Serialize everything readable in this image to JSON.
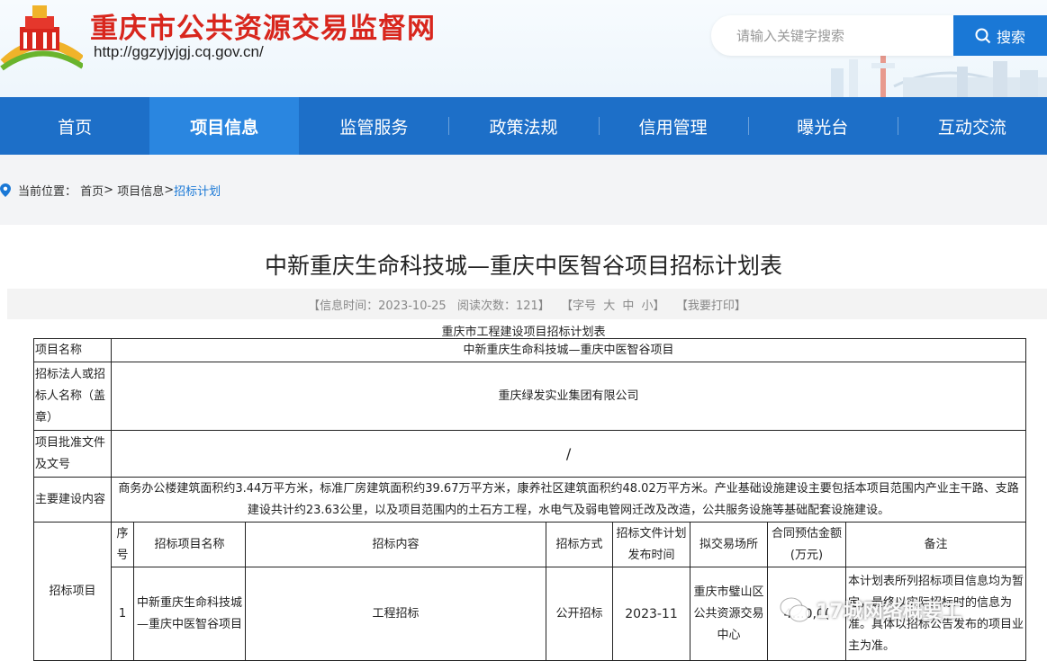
{
  "header": {
    "site_title": "重庆市公共资源交易监督网",
    "site_url": "http://ggzyjyjgj.cq.gov.cn/",
    "search_placeholder": "请输入关键字搜索",
    "search_button": "搜索"
  },
  "nav": {
    "items": [
      {
        "label": "首页"
      },
      {
        "label": "项目信息",
        "active": true
      },
      {
        "label": "监管服务"
      },
      {
        "label": "政策法规"
      },
      {
        "label": "信用管理"
      },
      {
        "label": "曝光台"
      },
      {
        "label": "互动交流"
      }
    ]
  },
  "breadcrumb": {
    "prefix": "当前位置：",
    "home": "首页",
    "sep1": ">",
    "section": "项目信息",
    "sep2": ">",
    "current": "招标计划"
  },
  "article": {
    "title": "中新重庆生命科技城—重庆中医智谷项目招标计划表",
    "meta": {
      "time": "【信息时间：2023-10-25",
      "views": "阅读次数：121】",
      "font_label": "【字号",
      "font_big": "大",
      "font_mid": "中",
      "font_small": "小】",
      "print": "【我要打印】"
    },
    "table_caption": "重庆市工程建设项目招标计划表",
    "table": {
      "project_name_label": "项目名称",
      "project_name": "中新重庆生命科技城—重庆中医智谷项目",
      "tenderer_label": "招标法人或招标人名称（盖章）",
      "tenderer": "重庆绿发实业集团有限公司",
      "approval_label": "项目批准文件及文号",
      "approval": "/",
      "content_label": "主要建设内容",
      "content": "商务办公楼建筑面积约3.44万平方米，标准厂房建筑面积约39.67万平方米，康养社区建筑面积约48.02万平方米。产业基础设施建设主要包括本项目范围内产业主干路、支路建设共计约23.63公里，以及项目范围内的土石方工程，水电气及弱电管网迁改及改造，公共服务设施等基础配套设施建设。",
      "tender_items_label": "招标项目",
      "headers": [
        "序号",
        "招标项目名称",
        "招标内容",
        "招标方式",
        "招标文件计划发布时间",
        "拟交易场所",
        "合同预估金额(万元)",
        "备注"
      ],
      "rows": [
        {
          "seq": "1",
          "name": "中新重庆生命科技城—重庆中医智谷项目",
          "content": "工程招标",
          "method": "公开招标",
          "time": "2023-11",
          "venue": "重庆市璧山区公共资源交易中心",
          "amount": "4…0,0(",
          "remark": "本计划表所列招标项目信息均为暂定，最终以实际招标时的信息为准。具体以招标公告发布的项目业主为准。"
        }
      ]
    }
  },
  "watermark": {
    "text": "17城网络概要工"
  }
}
